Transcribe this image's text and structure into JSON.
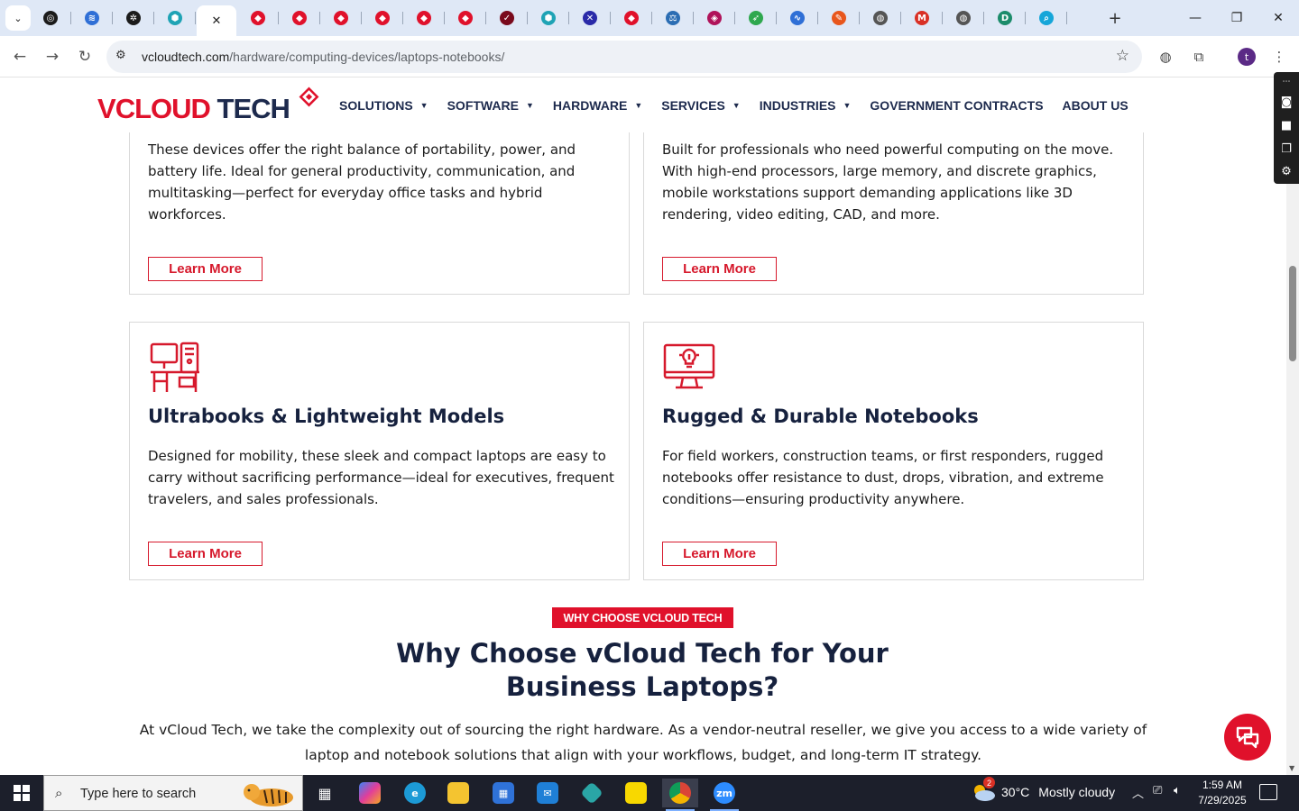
{
  "browser": {
    "tabs": [
      {
        "icon": "openai-icon",
        "color": "#1b1b1b",
        "glyph": "◎"
      },
      {
        "icon": "wifi-signal-icon",
        "color": "#2f6fd6",
        "glyph": "≋"
      },
      {
        "icon": "openai-icon",
        "color": "#1b1b1b",
        "glyph": "✲"
      },
      {
        "icon": "hexagon-app-icon",
        "color": "#1fa3b5",
        "glyph": "⬢"
      },
      {
        "icon": "diamond-tag-icon",
        "color": "#e0112b",
        "glyph": "◆"
      },
      {
        "icon": "diamond-tag-icon",
        "color": "#e0112b",
        "glyph": "◆"
      },
      {
        "icon": "diamond-tag-icon",
        "color": "#e0112b",
        "glyph": "◆"
      },
      {
        "icon": "diamond-tag-icon",
        "color": "#e0112b",
        "glyph": "◆"
      },
      {
        "icon": "diamond-tag-icon",
        "color": "#e0112b",
        "glyph": "◆"
      },
      {
        "icon": "diamond-tag-icon",
        "color": "#e0112b",
        "glyph": "◆"
      },
      {
        "icon": "diamond-tag-icon",
        "color": "#e0112b",
        "glyph": "◆"
      },
      {
        "icon": "checkmark-v-icon",
        "color": "#7a0a1c",
        "glyph": "✓"
      },
      {
        "icon": "hexagon-app-icon",
        "color": "#1fa3b5",
        "glyph": "⬢"
      },
      {
        "icon": "x-cross-icon",
        "color": "#2a2aa8",
        "glyph": "✕"
      },
      {
        "icon": "diamond-tag-icon",
        "color": "#e0112b",
        "glyph": "◆"
      },
      {
        "icon": "scales-icon",
        "color": "#2b6db3",
        "glyph": "⚖"
      },
      {
        "icon": "diamond-pink-icon",
        "color": "#b0135a",
        "glyph": "◈"
      },
      {
        "icon": "feather-icon",
        "color": "#2fa84f",
        "glyph": "➶"
      },
      {
        "icon": "pulse-icon",
        "color": "#2f6fd6",
        "glyph": "∿"
      },
      {
        "icon": "signature-icon",
        "color": "#e8561c",
        "glyph": "✎"
      },
      {
        "icon": "globe-icon",
        "color": "#555555",
        "glyph": "◍"
      },
      {
        "icon": "gmail-icon",
        "color": "#d93025",
        "glyph": "M"
      },
      {
        "icon": "globe-icon",
        "color": "#555555",
        "glyph": "◍"
      },
      {
        "icon": "d-letter-icon",
        "color": "#1c8c6b",
        "glyph": "D"
      },
      {
        "icon": "search-app-icon",
        "color": "#16a6d9",
        "glyph": "⌕"
      }
    ],
    "active_tab_index": 4,
    "url_host": "vcloudtech.com",
    "url_path": "/hardware/computing-devices/laptops-notebooks/",
    "profile_initial": "t"
  },
  "site": {
    "logo_v": "V",
    "logo_cloud": "CLOUD",
    "logo_tech": " TECH",
    "nav": [
      {
        "label": "SOLUTIONS",
        "has_menu": true
      },
      {
        "label": "SOFTWARE",
        "has_menu": true
      },
      {
        "label": "HARDWARE",
        "has_menu": true
      },
      {
        "label": "SERVICES",
        "has_menu": true
      },
      {
        "label": "INDUSTRIES",
        "has_menu": true
      },
      {
        "label": "GOVERNMENT CONTRACTS",
        "has_menu": false
      },
      {
        "label": "ABOUT US",
        "has_menu": false
      }
    ]
  },
  "cards": [
    {
      "title": "",
      "text": "These devices offer the right balance of portability, power, and battery life. Ideal for general productivity, communication, and multitasking—perfect for everyday office tasks and hybrid workforces.",
      "button": "Learn More"
    },
    {
      "title": "",
      "text": "Built for professionals who need powerful computing on the move. With high-end processors, large memory, and discrete graphics, mobile workstations support demanding applications like 3D rendering, video editing, CAD, and more.",
      "button": "Learn More"
    },
    {
      "title": "Ultrabooks & Lightweight Models",
      "icon": "desk-workstation-icon",
      "text": "Designed for mobility, these sleek and compact laptops are easy to carry without sacrificing performance—ideal for executives, frequent travelers, and sales professionals.",
      "button": "Learn More"
    },
    {
      "title": "Rugged & Durable Notebooks",
      "icon": "monitor-lightbulb-icon",
      "text": "For field workers, construction teams, or first responders, rugged notebooks offer resistance to dust, drops, vibration, and extreme conditions—ensuring productivity anywhere.",
      "button": "Learn More"
    }
  ],
  "why": {
    "badge": "WHY CHOOSE VCLOUD TECH",
    "title": "Why Choose vCloud Tech for Your Business Laptops?",
    "text": "At vCloud Tech, we take the complexity out of sourcing the right hardware. As a vendor-neutral reseller, we give you access to a wide variety of laptop and notebook solutions that align with your workflows, budget, and long-term IT strategy."
  },
  "taskbar": {
    "search_placeholder": "Type here to search",
    "weather_temp": "30°C",
    "weather_desc": "Mostly cloudy",
    "weather_badge": "2",
    "time": "1:59 AM",
    "date": "7/29/2025"
  },
  "colors": {
    "brand_red": "#e0112b",
    "brand_navy": "#16213e",
    "tabbar": "#dfe8f6",
    "taskbar": "#1c1f2b"
  }
}
